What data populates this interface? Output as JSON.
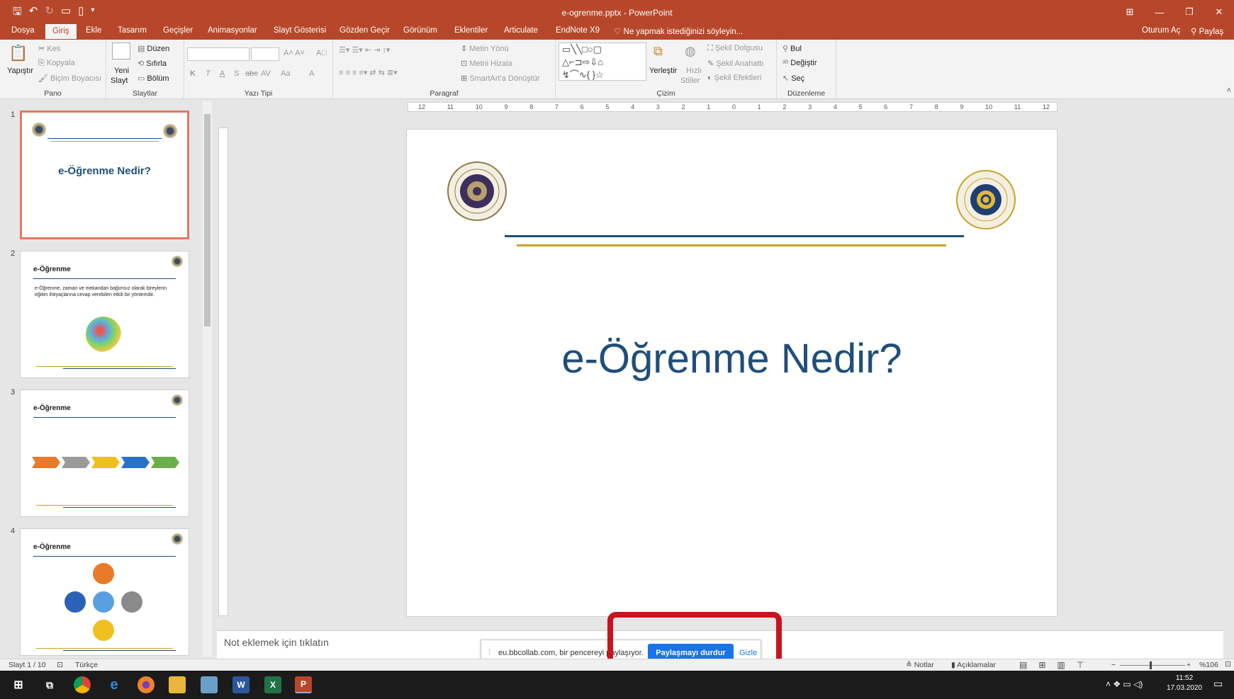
{
  "window": {
    "title": "e-ogrenme.pptx - PowerPoint"
  },
  "menu": {
    "tabs": [
      "Dosya",
      "Giriş",
      "Ekle",
      "Tasarım",
      "Geçişler",
      "Animasyonlar",
      "Slayt Gösterisi",
      "Gözden Geçir",
      "Görünüm",
      "Eklentiler",
      "Articulate",
      "EndNote X9"
    ],
    "tell_me": "Ne yapmak istediğinizi söyleyin...",
    "sign_in": "Oturum Aç",
    "share": "Paylaş"
  },
  "ribbon": {
    "pano": {
      "label": "Pano",
      "paste": "Yapıştır",
      "cut": "Kes",
      "copy": "Kopyala",
      "painter": "Biçim Boyacısı"
    },
    "slaytlar": {
      "label": "Slaytlar",
      "new1": "Yeni",
      "new2": "Slayt",
      "layout": "Düzen",
      "reset": "Sıfırla",
      "section": "Bölüm"
    },
    "yazi": {
      "label": "Yazı Tipi",
      "bold": "K",
      "italic": "T",
      "underline": "A",
      "shadow": "S",
      "strike": "abc",
      "spacing": "AV",
      "case": "Aa",
      "color": "A"
    },
    "paragraf": {
      "label": "Paragraf",
      "dir": "Metin Yönü",
      "align": "Metni Hizala",
      "smartart": "SmartArt'a Dönüştür"
    },
    "cizim": {
      "label": "Çizim",
      "arrange": "Yerleştir",
      "quick1": "Hızlı",
      "quick2": "Stiller",
      "fill": "Şekil Dolgusu",
      "outline": "Şekil Anahattı",
      "effects": "Şekil Efektleri"
    },
    "duzenleme": {
      "label": "Düzenleme",
      "find": "Bul",
      "replace": "Değiştir",
      "select": "Seç"
    }
  },
  "ruler": {
    "ticks": [
      "12",
      "11",
      "10",
      "9",
      "8",
      "7",
      "6",
      "5",
      "4",
      "3",
      "2",
      "1",
      "0",
      "1",
      "2",
      "3",
      "4",
      "5",
      "6",
      "7",
      "8",
      "9",
      "10",
      "11",
      "12"
    ]
  },
  "thumbnails": [
    {
      "num": "1",
      "title": "e-Öğrenme Nedir?"
    },
    {
      "num": "2",
      "title": "e-Öğrenme",
      "bullet": "e-Öğrenme, zaman ve mekandan bağımsız olarak bireylerin eğitim ihtiyaçlarına cevap verebilen etkili bir yöntemdir."
    },
    {
      "num": "3",
      "title": "e-Öğrenme"
    },
    {
      "num": "4",
      "title": "e-Öğrenme"
    }
  ],
  "slide": {
    "title": "e-Öğrenme Nedir?"
  },
  "notes": {
    "placeholder": "Not eklemek için tıklatın"
  },
  "sharebar": {
    "message": "eu.bbcollab.com, bir pencereyi paylaşıyor.",
    "stop": "Paylaşmayı durdur",
    "hide": "Gizle"
  },
  "status": {
    "slide": "Slayt 1 / 10",
    "lang": "Türkçe",
    "notes": "Notlar",
    "comments": "Açıklamalar",
    "zoom": "%106"
  },
  "taskbar": {
    "time": "11:52",
    "date": "17.03.2020"
  },
  "colors": {
    "accent": "#b7472a",
    "slide_title": "#1f4e79",
    "gold": "#c9a227",
    "share_btn": "#1a73e8",
    "highlight": "#c8141e"
  }
}
